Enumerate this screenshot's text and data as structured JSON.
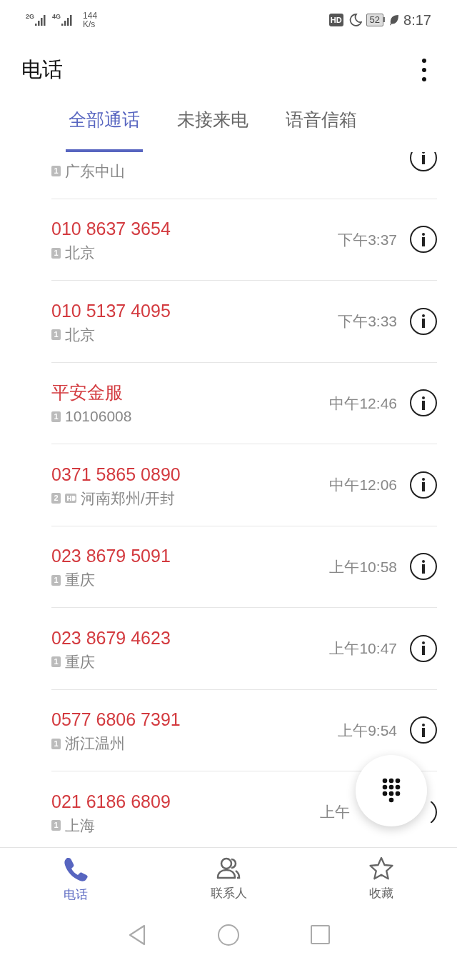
{
  "status_bar": {
    "network_1": "2G",
    "network_2": "4G",
    "speed": "144",
    "speed_unit": "K/s",
    "hd": "HD",
    "battery": "52",
    "time": "8:17"
  },
  "header": {
    "title": "电话"
  },
  "tabs": [
    {
      "label": "全部通话",
      "selected": true
    },
    {
      "label": "未接来电",
      "selected": false
    },
    {
      "label": "语音信箱",
      "selected": false
    }
  ],
  "calls": [
    {
      "location": "广东中山",
      "sim": "1",
      "top_cut": true
    },
    {
      "name": "010 8637 3654",
      "location": "北京",
      "time": "下午3:37",
      "sim": "1"
    },
    {
      "name": "010 5137 4095",
      "location": "北京",
      "time": "下午3:33",
      "sim": "1"
    },
    {
      "name": "平安金服",
      "location": "10106008",
      "time": "中午12:46",
      "sim": "1"
    },
    {
      "name": "0371 5865 0890",
      "location": "河南郑州/开封",
      "time": "中午12:06",
      "sim": "2",
      "hd": true
    },
    {
      "name": "023 8679 5091",
      "location": "重庆",
      "time": "上午10:58",
      "sim": "1"
    },
    {
      "name": "023 8679 4623",
      "location": "重庆",
      "time": "上午10:47",
      "sim": "1"
    },
    {
      "name": "0577 6806 7391",
      "location": "浙江温州",
      "time": "上午9:54",
      "sim": "1"
    },
    {
      "name": "021 6186 6809",
      "location": "上海",
      "time": "上午",
      "sim": "1",
      "time_covered": true
    }
  ],
  "bottom_nav": [
    {
      "label": "电话",
      "kind": "phone",
      "selected": true
    },
    {
      "label": "联系人",
      "kind": "contacts",
      "selected": false
    },
    {
      "label": "收藏",
      "kind": "star",
      "selected": false
    }
  ]
}
